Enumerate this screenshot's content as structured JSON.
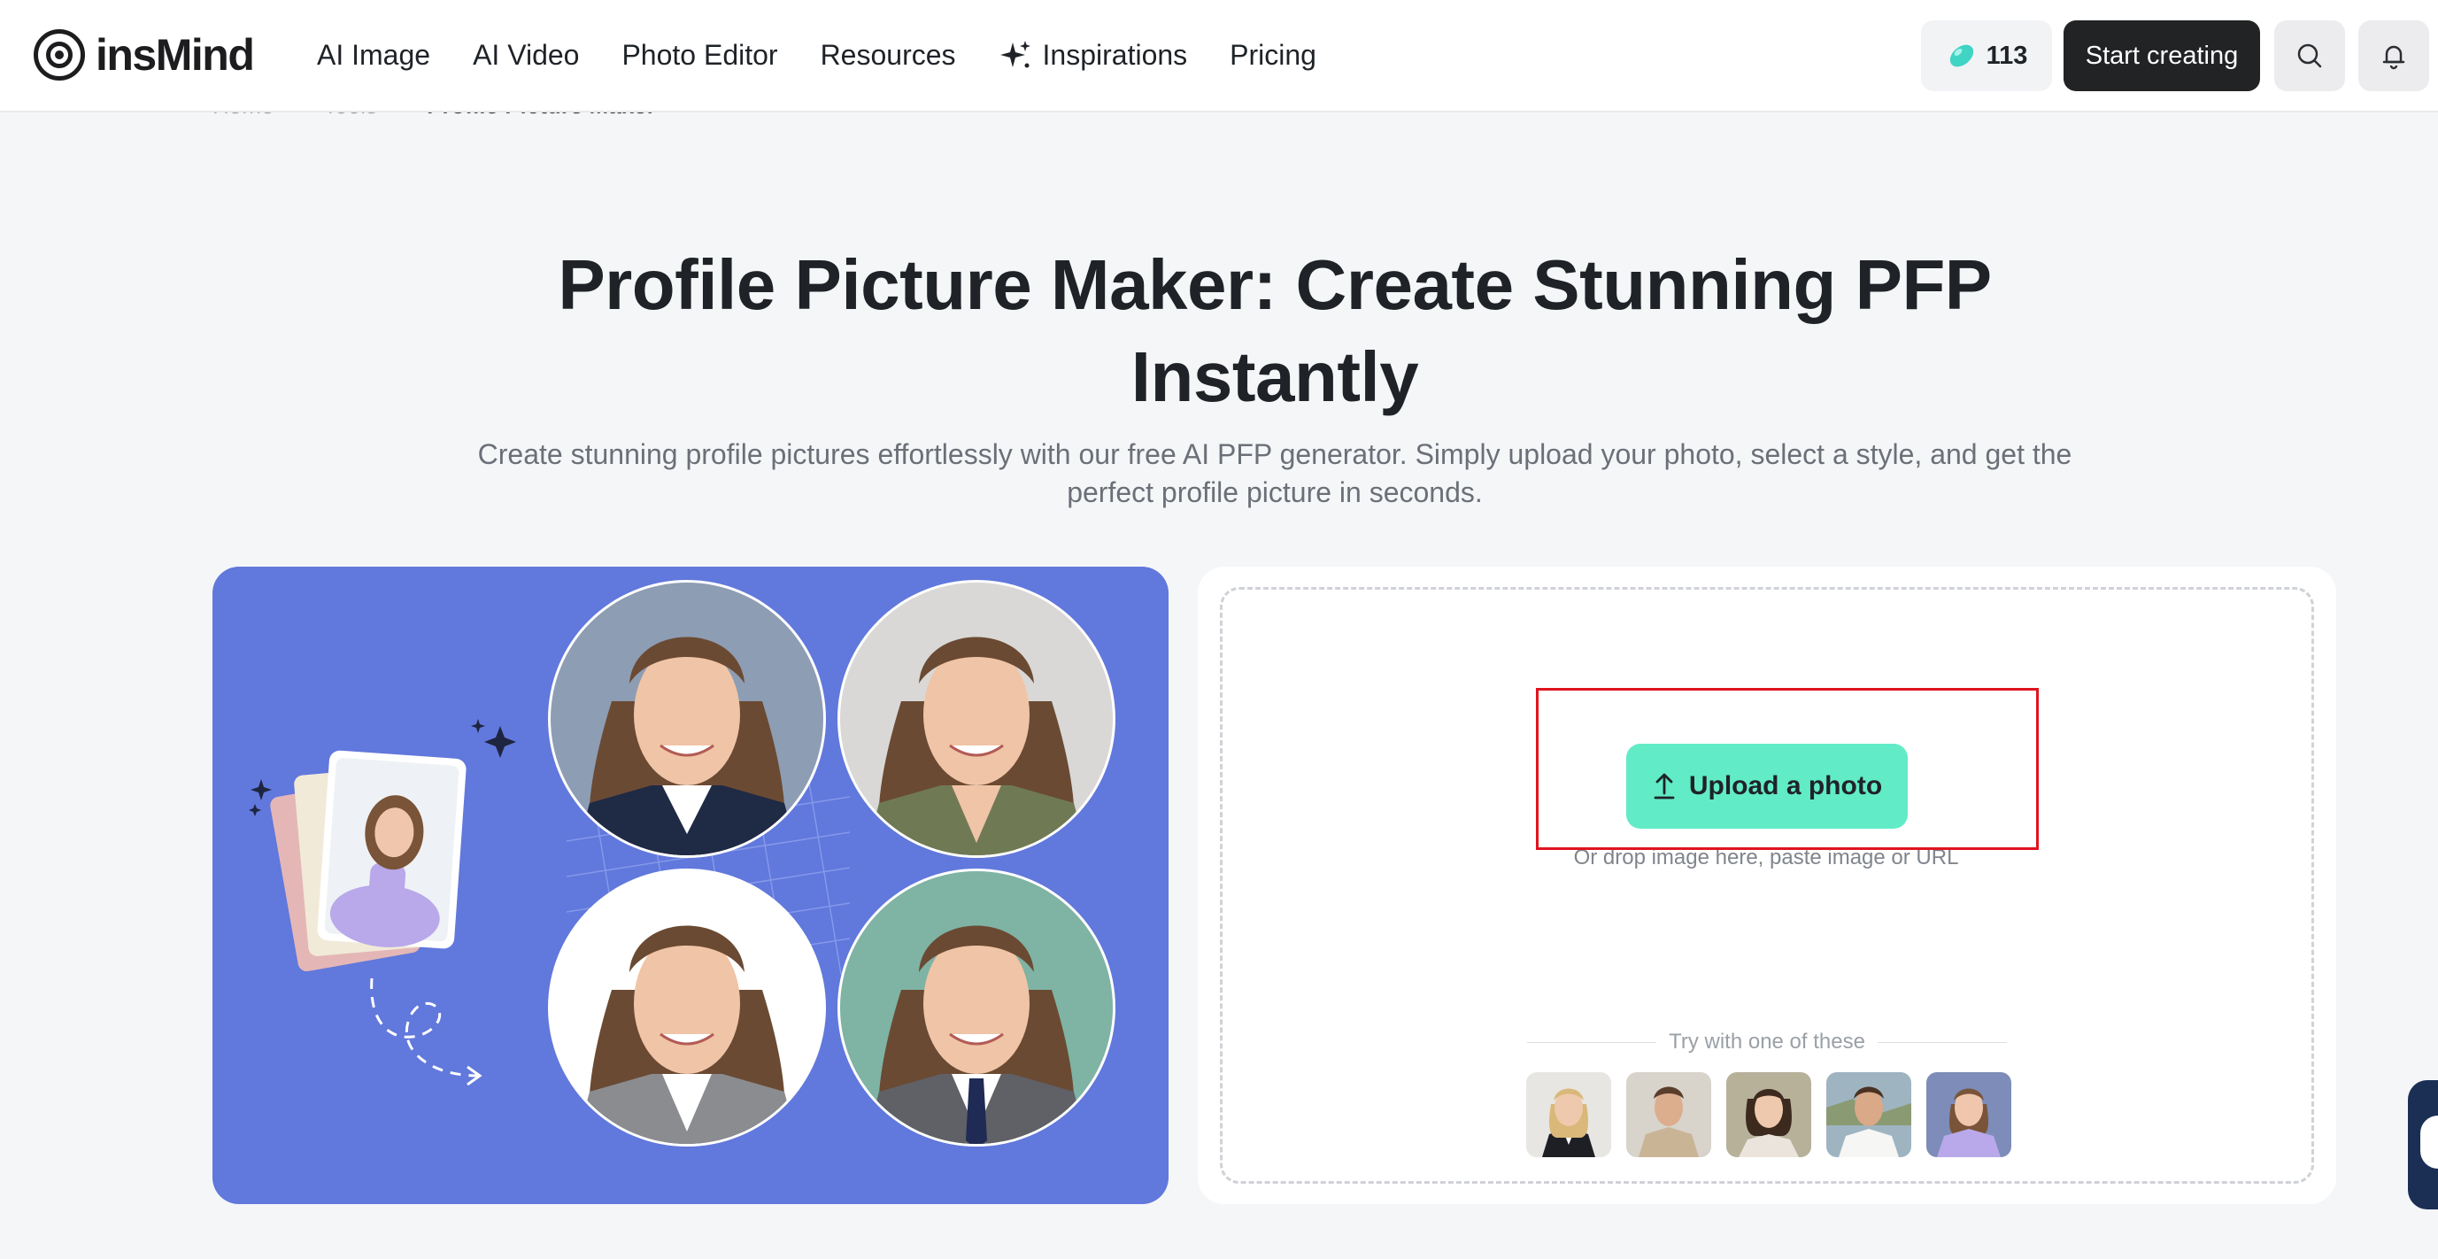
{
  "brand": {
    "name": "insMind"
  },
  "nav": {
    "items": [
      {
        "label": "AI Image"
      },
      {
        "label": "AI Video"
      },
      {
        "label": "Photo Editor"
      },
      {
        "label": "Resources"
      },
      {
        "label": "Inspirations",
        "icon": "sparkle-icon"
      },
      {
        "label": "Pricing"
      }
    ]
  },
  "account": {
    "credits": "113",
    "start_label": "Start creating"
  },
  "breadcrumb": [
    "Home",
    "Tools",
    "Profile Picture Maker"
  ],
  "hero": {
    "title": "Profile Picture Maker: Create Stunning PFP Instantly",
    "subtitle": "Create stunning profile pictures effortlessly with our free AI PFP generator. Simply upload your photo, select a style, and get the perfect profile picture in seconds."
  },
  "upload": {
    "button_label": "Upload a photo",
    "hint": "Or drop image here, paste image or URL",
    "try_label": "Try with one of these",
    "samples": [
      {
        "name": "sample-blonde-woman-suit"
      },
      {
        "name": "sample-man-beige-shirt"
      },
      {
        "name": "sample-woman-short-hair"
      },
      {
        "name": "sample-man-white-shirt"
      },
      {
        "name": "sample-woman-lilac-sweater"
      }
    ]
  },
  "colors": {
    "showcase_bg": "#6178dc",
    "upload_button": "#62ebc7",
    "highlight": "#e0141e",
    "start_button": "#222325"
  }
}
